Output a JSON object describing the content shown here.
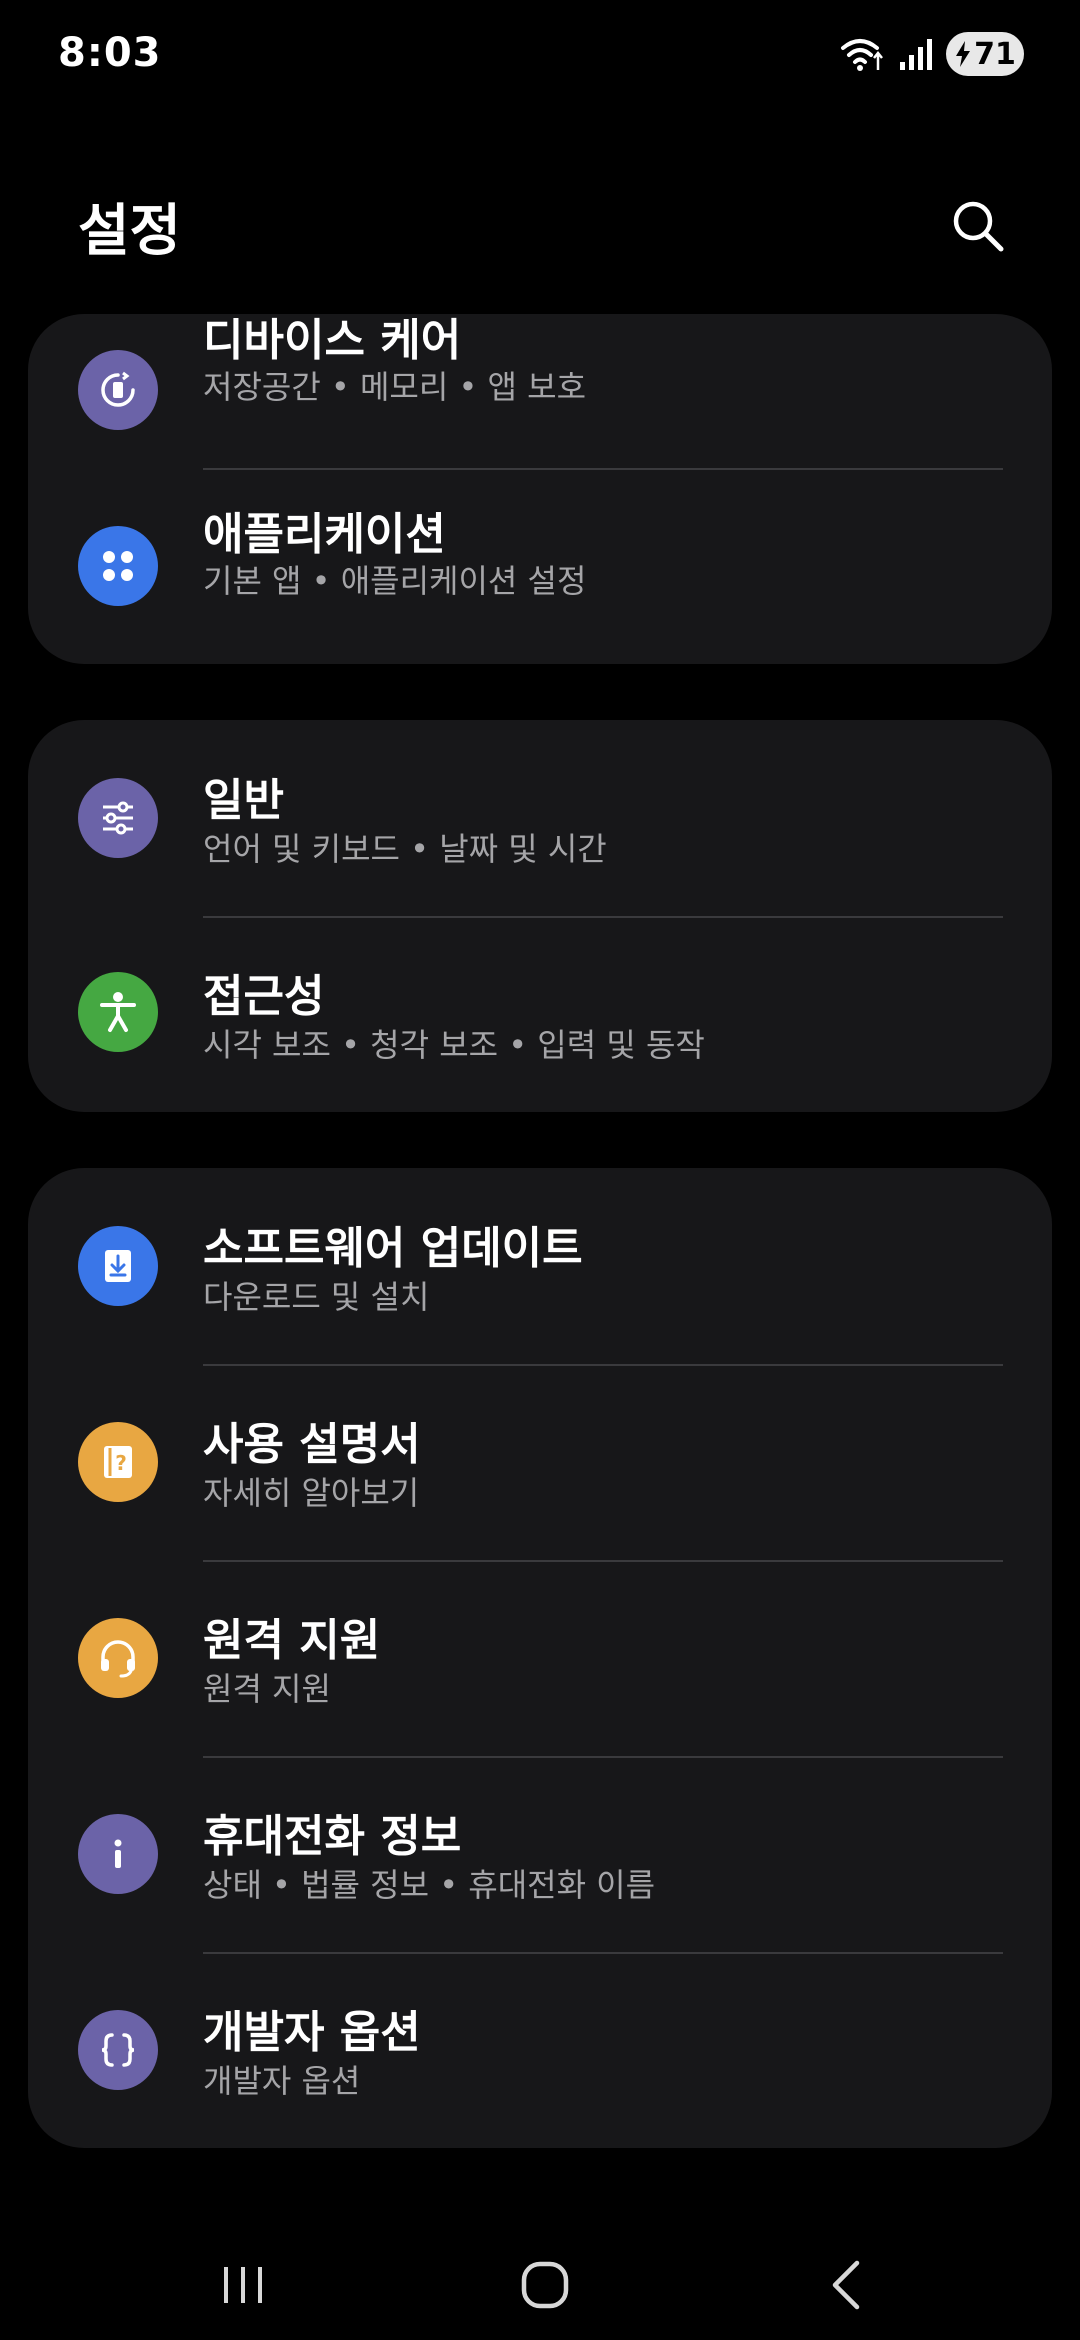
{
  "status_bar": {
    "time": "8:03",
    "battery_level": "71",
    "icons": [
      "wifi-icon",
      "signal-icon",
      "battery-charging-icon"
    ]
  },
  "header": {
    "title": "설정",
    "search_icon": "search-icon"
  },
  "colors": {
    "background": "#000000",
    "card": "#171719",
    "subtitle": "#a5a5a8",
    "icon_purple": "#6b63a8",
    "icon_blue": "#3a76e8",
    "icon_green": "#45a842",
    "icon_orange": "#e8a742"
  },
  "cards": [
    {
      "items": [
        {
          "title": "디바이스 케어",
          "subtitle": "저장공간  •  메모리  •  앱 보호",
          "icon": "device-care-icon"
        },
        {
          "title": "애플리케이션",
          "subtitle": "기본 앱  •  애플리케이션 설정",
          "icon": "apps-icon"
        }
      ]
    },
    {
      "items": [
        {
          "title": "일반",
          "subtitle": "언어 및 키보드  •  날짜 및 시간",
          "icon": "sliders-icon"
        },
        {
          "title": "접근성",
          "subtitle": "시각 보조  •  청각 보조  •  입력 및 동작",
          "icon": "accessibility-icon"
        }
      ]
    },
    {
      "items": [
        {
          "title": "소프트웨어 업데이트",
          "subtitle": "다운로드 및 설치",
          "icon": "software-update-icon"
        },
        {
          "title": "사용 설명서",
          "subtitle": "자세히 알아보기",
          "icon": "user-manual-icon"
        },
        {
          "title": "원격 지원",
          "subtitle": "원격 지원",
          "icon": "headset-icon"
        },
        {
          "title": "휴대전화 정보",
          "subtitle": "상태  •  법률 정보  •  휴대전화 이름",
          "icon": "info-icon"
        },
        {
          "title": "개발자 옵션",
          "subtitle": "개발자 옵션",
          "icon": "developer-options-icon"
        }
      ]
    }
  ],
  "nav_bar": {
    "icons": [
      "recent-apps-icon",
      "home-icon",
      "back-icon"
    ]
  }
}
